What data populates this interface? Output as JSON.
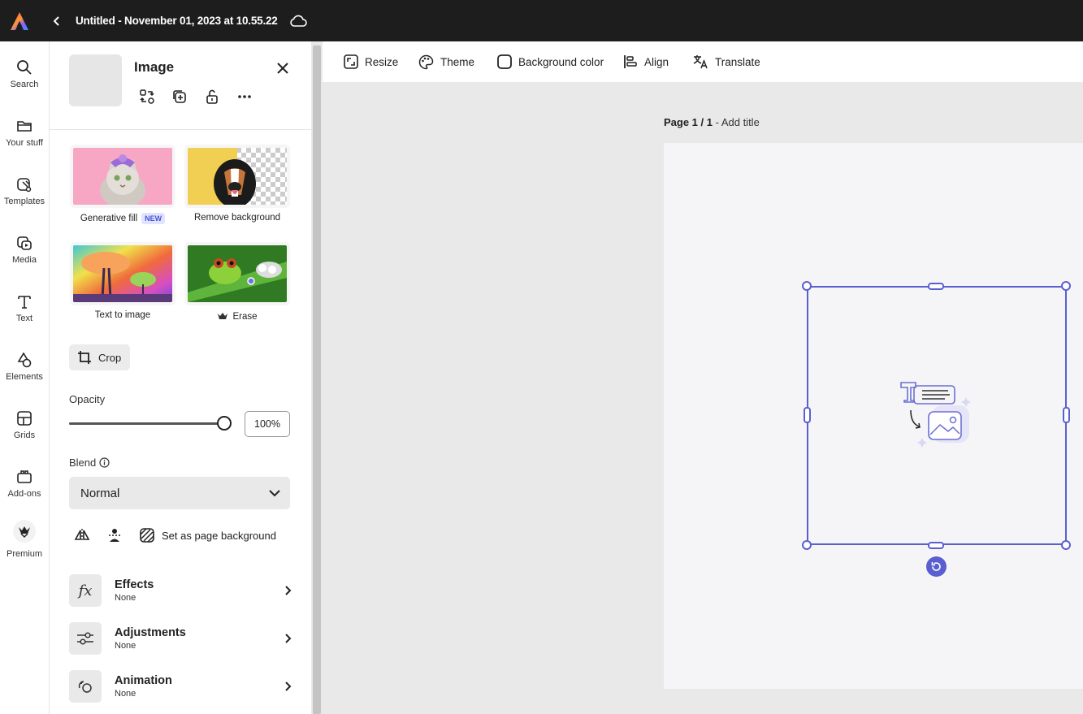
{
  "app": {
    "doc_title": "Untitled - November 01, 2023 at 10.55.22"
  },
  "rail": {
    "items": [
      {
        "label": "Search",
        "icon": "search-icon"
      },
      {
        "label": "Your stuff",
        "icon": "folder-icon"
      },
      {
        "label": "Templates",
        "icon": "templates-icon"
      },
      {
        "label": "Media",
        "icon": "media-icon"
      },
      {
        "label": "Text",
        "icon": "text-icon"
      },
      {
        "label": "Elements",
        "icon": "elements-icon"
      },
      {
        "label": "Grids",
        "icon": "grids-icon"
      },
      {
        "label": "Add-ons",
        "icon": "addons-icon"
      },
      {
        "label": "Premium",
        "icon": "premium-crown-icon"
      }
    ]
  },
  "panel": {
    "title": "Image",
    "quick_actions": [
      {
        "label": "Generative fill",
        "badge": "NEW"
      },
      {
        "label": "Remove background"
      },
      {
        "label": "Text to image"
      },
      {
        "label": "Erase"
      }
    ],
    "crop_label": "Crop",
    "opacity_label": "Opacity",
    "opacity_value": "100%",
    "opacity_fraction": 1.0,
    "blend_label": "Blend",
    "blend_value": "Normal",
    "set_bg_label": "Set as page background",
    "sections": [
      {
        "title": "Effects",
        "sub": "None",
        "icon": "fx-icon"
      },
      {
        "title": "Adjustments",
        "sub": "None",
        "icon": "sliders-icon"
      },
      {
        "title": "Animation",
        "sub": "None",
        "icon": "animation-icon"
      }
    ]
  },
  "toolbar": {
    "resize": "Resize",
    "theme": "Theme",
    "background_color": "Background color",
    "align": "Align",
    "translate": "Translate"
  },
  "canvas": {
    "page_label_bold": "Page 1 / 1",
    "page_label_rest": " - Add title"
  },
  "colors": {
    "accent": "#5a5fd0",
    "topbar": "#1d1d1d"
  }
}
